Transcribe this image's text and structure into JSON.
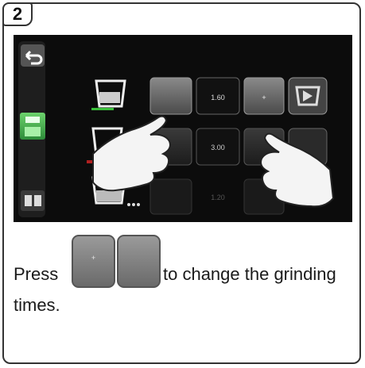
{
  "step": {
    "number": "2"
  },
  "display": {
    "rows": [
      {
        "time": "1.60"
      },
      {
        "time": "3.00"
      },
      {
        "time": "1.20"
      }
    ],
    "minus_glyph": "-",
    "plus_glyph": "+"
  },
  "instruction": {
    "before": "Press",
    "after": "to change the grinding",
    "line2": "times.",
    "plus_glyph": "+",
    "minus_glyph": ""
  },
  "colors": {
    "screen_bg": "#0c0c0c",
    "button_gray": "#6e6e6e",
    "save_green": "#3ea84a",
    "border": "#333333"
  },
  "icons": [
    "back-icon",
    "save-icon",
    "menu-icon",
    "cup-icon",
    "play-icon",
    "hand-icon"
  ]
}
